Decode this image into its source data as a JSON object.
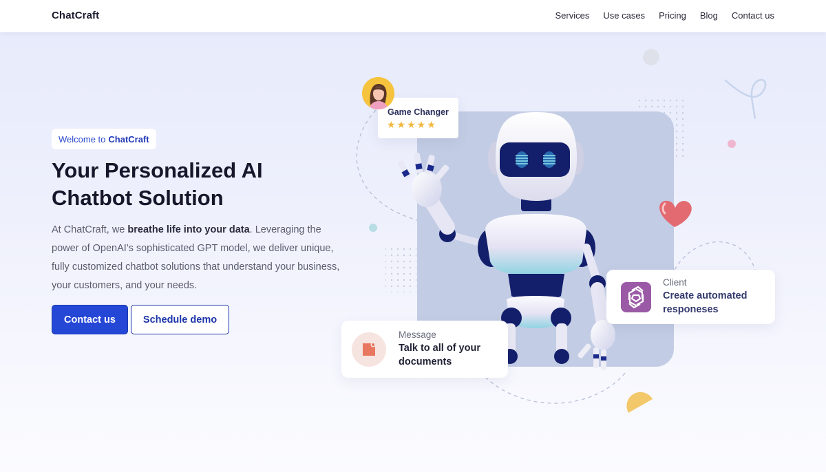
{
  "nav": {
    "brand": "ChatCraft",
    "links": [
      "Services",
      "Use cases",
      "Pricing",
      "Blog",
      "Contact us"
    ]
  },
  "hero": {
    "badge_prefix": "Welcome to",
    "badge_brand": "ChatCraft",
    "title_line1": "Your Personalized AI",
    "title_line2": "Chatbot Solution",
    "desc_part1": "At ChatCraft, we ",
    "desc_bold": "breathe life into your data",
    "desc_part2": ". Leveraging the power of OpenAI's sophisticated GPT model, we deliver unique, fully customized chatbot solutions that understand your business, your customers, and your needs.",
    "primary_button": "Contact us",
    "secondary_button": "Schedule demo"
  },
  "illustration": {
    "game_card": {
      "title": "Game Changer",
      "stars": "★★★★★",
      "rating": 5
    },
    "message_card": {
      "label": "Message",
      "text_line1": "Talk to all of your",
      "text_line2": "documents"
    },
    "client_card": {
      "label": "Client",
      "text_line1": "Create automated",
      "text_line2": "responeses"
    }
  },
  "icons": {
    "avatar": "woman-avatar-icon",
    "message": "document-icon",
    "client": "openai-logo-icon",
    "robot": "robot-illustration",
    "heart": "heart-icon"
  },
  "colors": {
    "primary": "#2447d6",
    "star": "#f3b73d",
    "panel": "#c2cce4",
    "client_icon": "#9b5aa6"
  }
}
